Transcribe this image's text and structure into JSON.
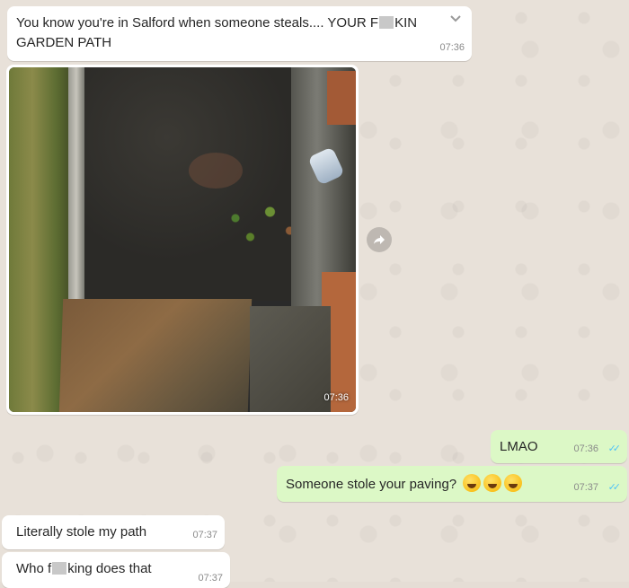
{
  "messages": [
    {
      "id": "m1",
      "text_before": "You know you're in Salford when someone steals.... YOUR F",
      "text_after": "KIN",
      "text_line2": "GARDEN PATH",
      "time": "07:36"
    },
    {
      "id": "m2",
      "kind": "photo",
      "time": "07:36"
    },
    {
      "id": "m3",
      "text": "LMAO",
      "time": "07:36"
    },
    {
      "id": "m4",
      "text": "Someone stole your paving?",
      "time": "07:37"
    },
    {
      "id": "m5",
      "text": "Literally stole my path",
      "time": "07:37"
    },
    {
      "id": "m6",
      "text_before": "Who f",
      "text_after": "king does that",
      "time": "07:37"
    }
  ],
  "icons": {
    "menu": "chevron-down-icon",
    "forward": "forward-icon",
    "read": "double-check-icon",
    "emoji": "rolling-on-floor-laughing-emoji-icon"
  },
  "colors": {
    "incoming": "#ffffff",
    "outgoing": "#dcf8c6",
    "ticks": "#4fc3f7",
    "background": "#e5ddd5"
  }
}
